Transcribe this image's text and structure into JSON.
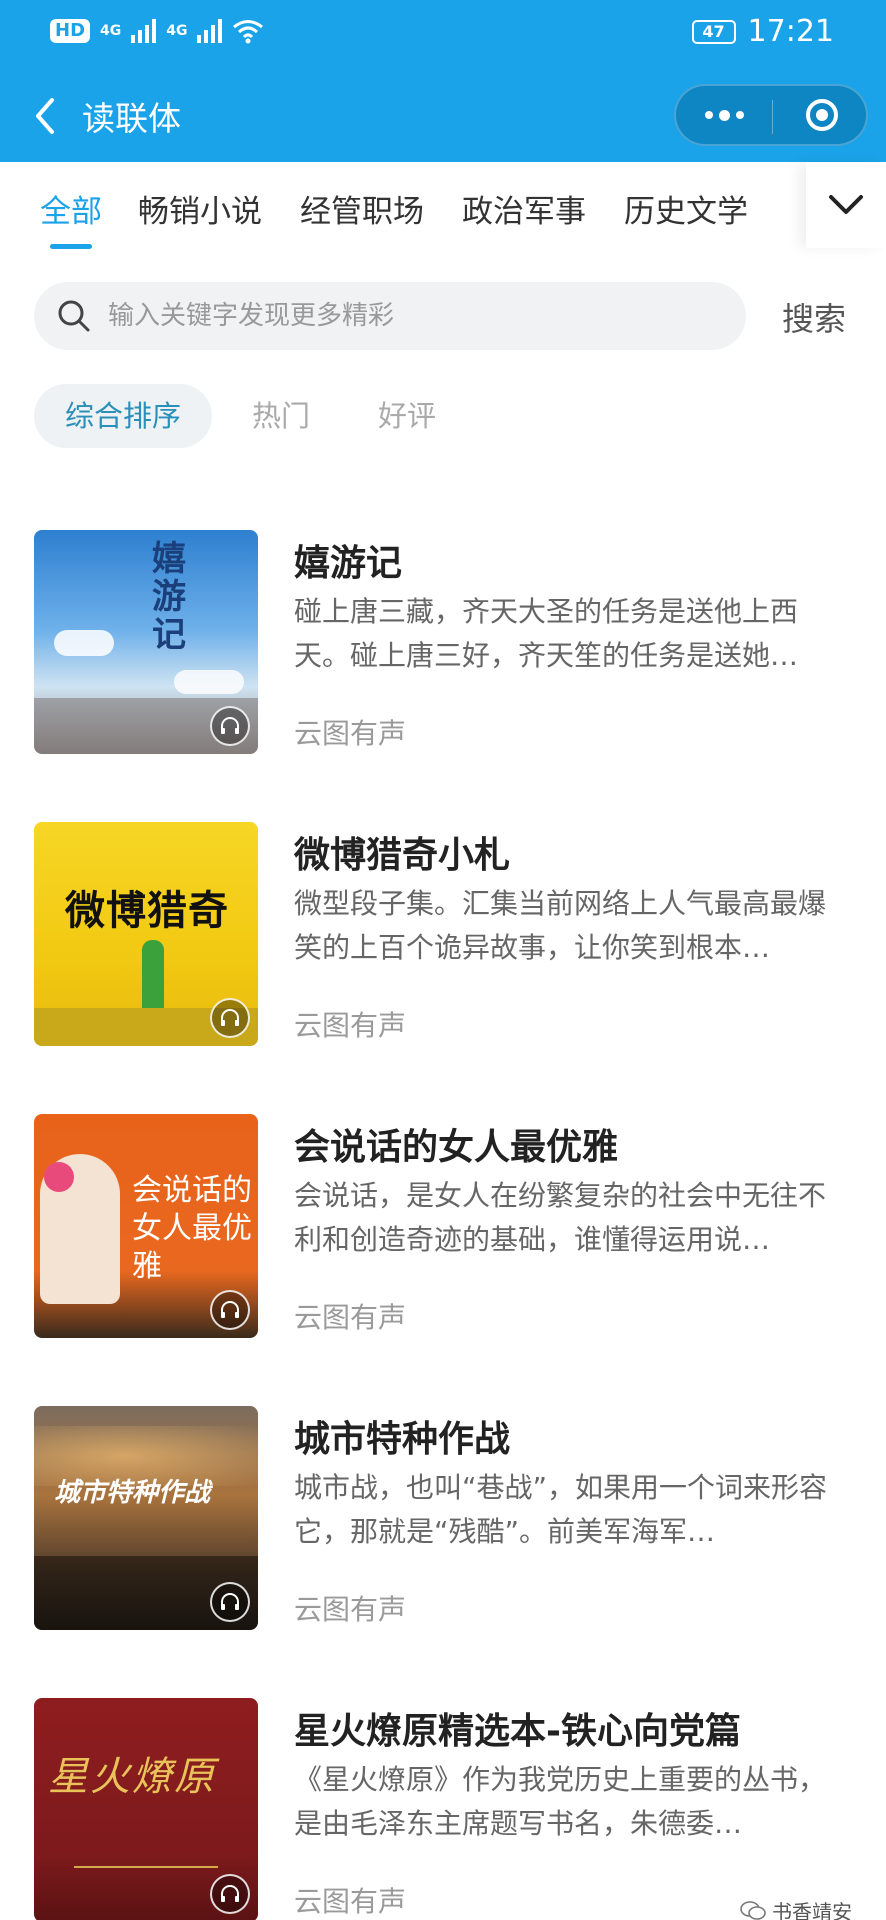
{
  "status_bar": {
    "hd": "HD",
    "net1": "4G",
    "net2": "4G",
    "battery": "47",
    "time": "17:21"
  },
  "titlebar": {
    "back_icon": "chevron-left-icon",
    "title": "读联体",
    "more_icon": "more-dots-icon",
    "target_icon": "target-circle-icon"
  },
  "tabs": [
    {
      "label": "全部",
      "active": true
    },
    {
      "label": "畅销小说",
      "active": false
    },
    {
      "label": "经管职场",
      "active": false
    },
    {
      "label": "政治军事",
      "active": false
    },
    {
      "label": "历史文学",
      "active": false
    }
  ],
  "search": {
    "placeholder": "输入关键字发现更多精彩",
    "button": "搜索"
  },
  "sort": [
    {
      "label": "综合排序",
      "active": true
    },
    {
      "label": "热门",
      "active": false
    },
    {
      "label": "好评",
      "active": false
    }
  ],
  "books": [
    {
      "title": "嬉游记",
      "desc": "碰上唐三藏，齐天大圣的任务是送他上西天。碰上唐三好，齐天笙的任务是送她…",
      "source": "云图有声",
      "cover_text": "嬉游记"
    },
    {
      "title": "微博猎奇小札",
      "desc": "微型段子集。汇集当前网络上人气最高最爆笑的上百个诡异故事，让你笑到根本…",
      "source": "云图有声",
      "cover_text": "微博猎奇"
    },
    {
      "title": "会说话的女人最优雅",
      "desc": "会说话，是女人在纷繁复杂的社会中无往不利和创造奇迹的基础，谁懂得运用说…",
      "source": "云图有声",
      "cover_text": "会说话的女人最优雅"
    },
    {
      "title": "城市特种作战",
      "desc": "城市战，也叫“巷战”，如果用一个词来形容它，那就是“残酷”。前美军海军…",
      "source": "云图有声",
      "cover_text": "城市特种作战"
    },
    {
      "title": "星火燎原精选本-铁心向党篇",
      "desc": "《星火燎原》作为我党历史上重要的丛书，是由毛泽东主席题写书名，朱德委…",
      "source": "云图有声",
      "cover_text": "星火燎原"
    }
  ],
  "watermark": "书香靖安"
}
